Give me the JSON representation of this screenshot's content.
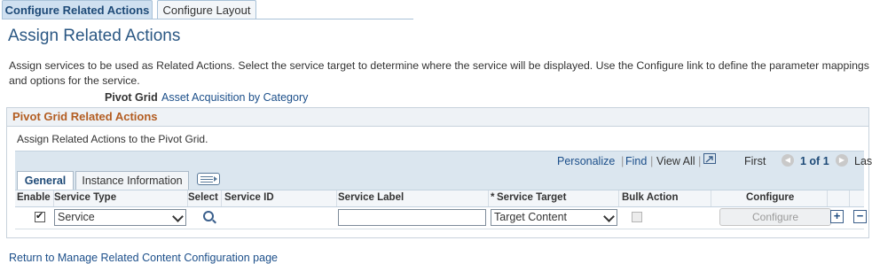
{
  "tabs": [
    {
      "label": "Configure Related Actions",
      "active": true
    },
    {
      "label": "Configure Layout",
      "active": false
    }
  ],
  "page_title": "Assign Related Actions",
  "description": "Assign services to be used as Related Actions. Select the service target to determine where the service will be displayed. Use the Configure link to define the parameter mappings and options for the service.",
  "pivot_grid": {
    "label": "Pivot Grid",
    "value": "Asset Acquisition by Category"
  },
  "group": {
    "title": "Pivot Grid Related Actions",
    "instruction": "Assign Related Actions to the Pivot Grid.",
    "grid_nav": {
      "personalize": "Personalize",
      "find": "Find",
      "view_all": "View All",
      "first": "First",
      "count": "1 of 1",
      "last": "Last",
      "sep": "|"
    },
    "grid_tabs": [
      {
        "label": "General",
        "active": true
      },
      {
        "label": "Instance Information",
        "active": false
      }
    ],
    "columns": {
      "enable": "Enable",
      "service_type": "Service Type",
      "select": "Select",
      "service_id": "Service ID",
      "service_label": "Service Label",
      "required_marker": "*",
      "service_target": "Service Target",
      "bulk_action": "Bulk Action",
      "configure": "Configure"
    },
    "row": {
      "enabled": true,
      "service_type": "Service",
      "service_id": "",
      "service_label": "",
      "service_target": "Target Content",
      "bulk_action": false,
      "configure_button": "Configure",
      "add": "+",
      "remove": "−"
    }
  },
  "return_link": "Return to Manage Related Content Configuration page",
  "colors": {
    "accent": "#1c4f8a",
    "group_title": "#b35d22",
    "grid_bar": "#dbe6ef"
  }
}
